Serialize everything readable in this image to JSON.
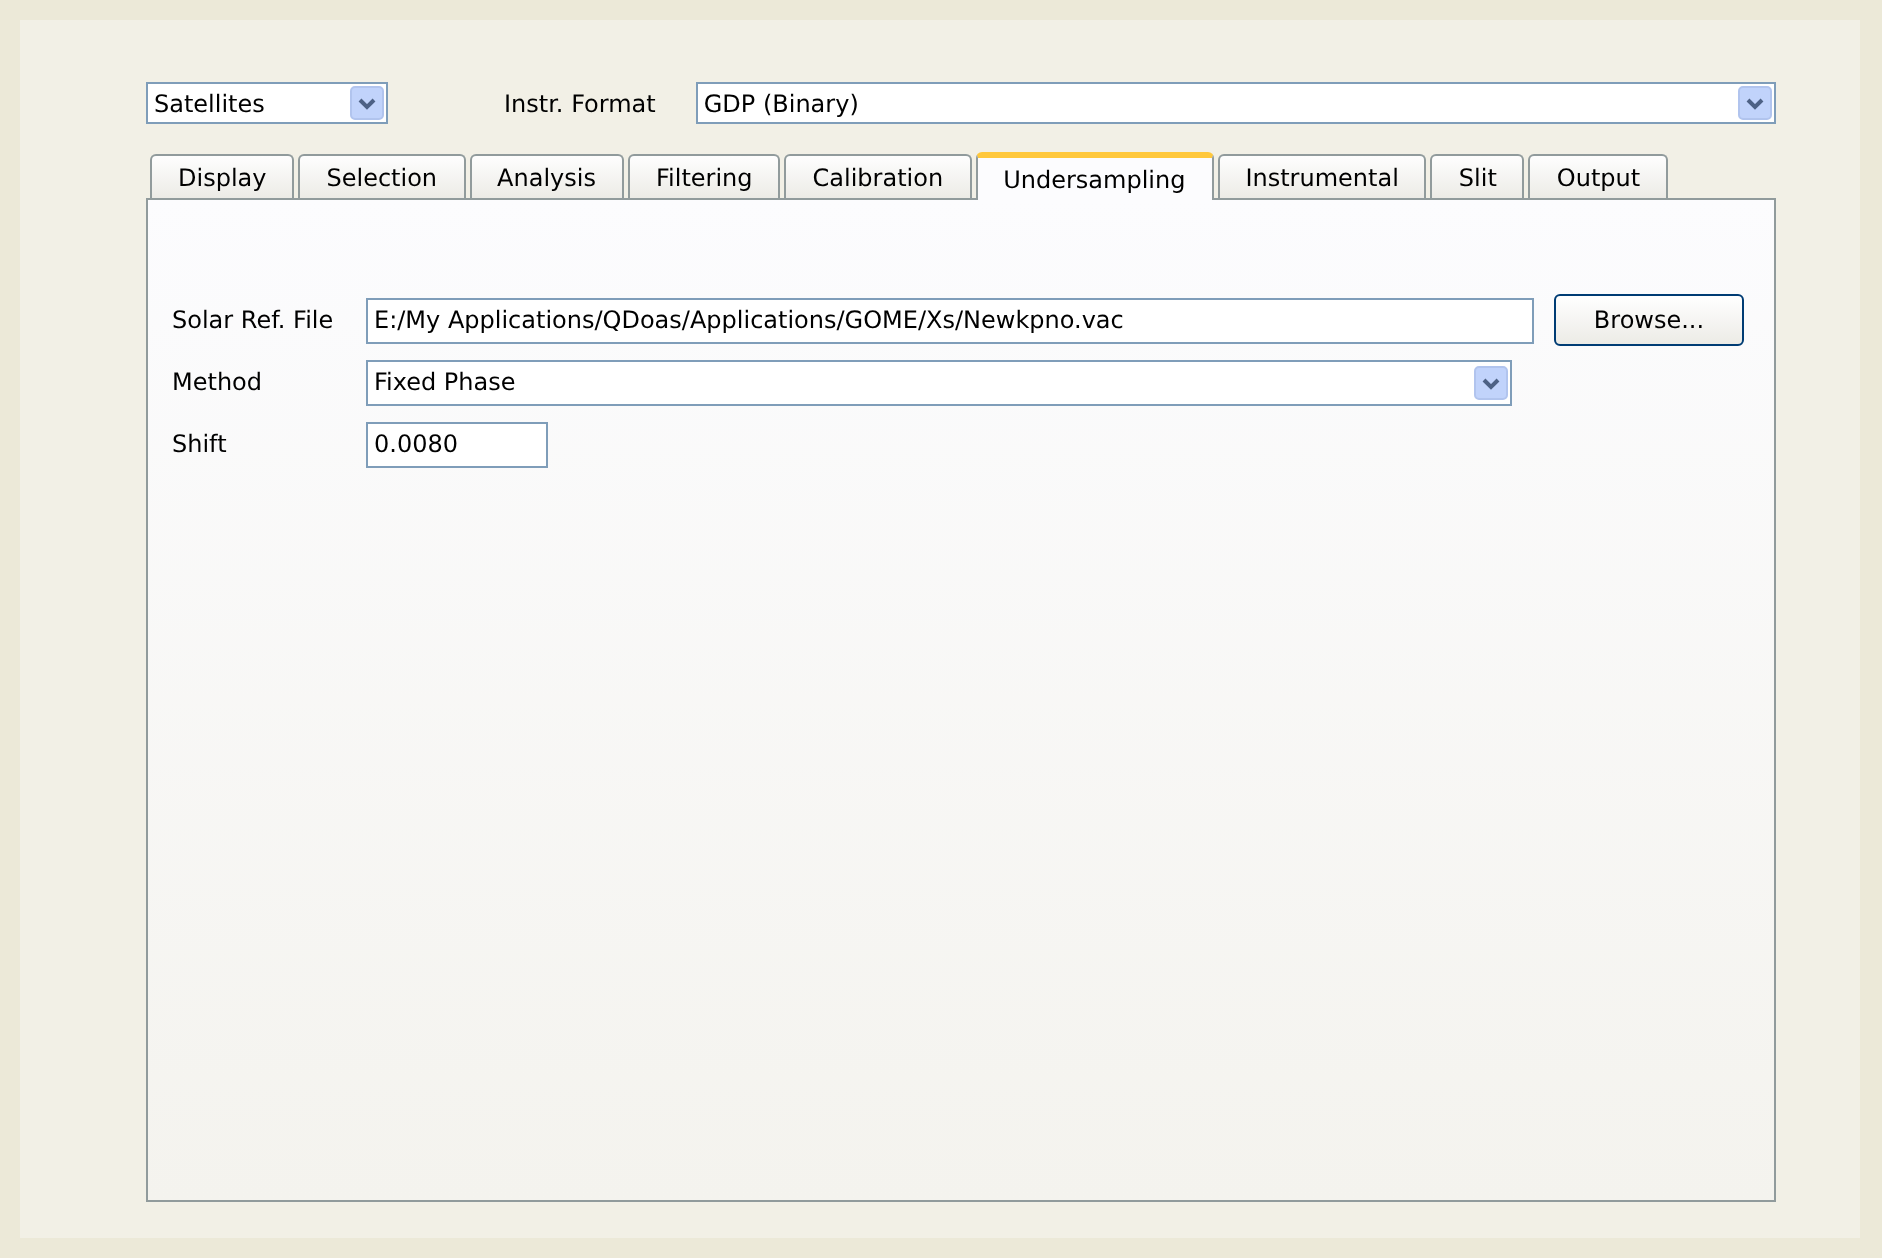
{
  "mode_select": {
    "value": "Satellites"
  },
  "instr_format": {
    "label": "Instr. Format",
    "value": "GDP (Binary)"
  },
  "tabs": [
    {
      "label": "Display",
      "selected": false
    },
    {
      "label": "Selection",
      "selected": false
    },
    {
      "label": "Analysis",
      "selected": false
    },
    {
      "label": "Filtering",
      "selected": false
    },
    {
      "label": "Calibration",
      "selected": false
    },
    {
      "label": "Undersampling",
      "selected": true
    },
    {
      "label": "Instrumental",
      "selected": false
    },
    {
      "label": "Slit",
      "selected": false
    },
    {
      "label": "Output",
      "selected": false
    }
  ],
  "fields": [
    {
      "kind": "file",
      "label": "Solar Ref. File",
      "value": "E:/My Applications/QDoas/Applications/GOME/Xs/Newkpno.vac",
      "button": "Browse..."
    },
    {
      "kind": "select",
      "label": "Method",
      "value": "Fixed Phase"
    },
    {
      "kind": "text",
      "label": "Shift",
      "value": "0.0080"
    }
  ]
}
